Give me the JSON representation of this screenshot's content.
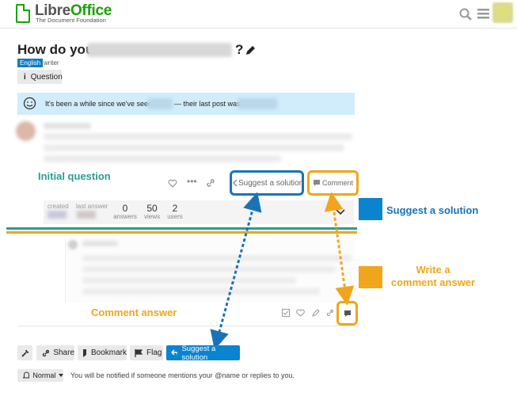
{
  "header": {
    "logo_name_prefix": "Libre",
    "logo_name_suffix": "Office",
    "logo_sub": "The Document Foundation"
  },
  "question": {
    "title_prefix": "How do you",
    "title_suffix": "?",
    "tags": [
      "English",
      "writer"
    ],
    "question_badge": "Question"
  },
  "notice": {
    "text_before": "It's been a while since we've seen",
    "text_middle": "— their last post was"
  },
  "post_actions": {
    "suggest": "Suggest a solution",
    "comment": "Comment"
  },
  "stats": {
    "created_label": "created",
    "last_answer_label": "last answer",
    "items": [
      {
        "value": "0",
        "label": "answers"
      },
      {
        "value": "50",
        "label": "views"
      },
      {
        "value": "2",
        "label": "users"
      }
    ]
  },
  "annotations": {
    "initial_question": "Initial question",
    "suggest_a_solution": "Suggest a solution",
    "write_comment_line1": "Write a",
    "write_comment_line2": "comment answer",
    "comment_answer": "Comment answer"
  },
  "footer": {
    "share": "Share",
    "bookmark": "Bookmark",
    "flag": "Flag",
    "suggest": "Suggest a solution",
    "notify_level": "Normal",
    "notify_text": "You will be notified if someone mentions your @name or replies to you."
  },
  "colors": {
    "blue": "#1a73b8",
    "orange": "#f1a51c",
    "green": "#2a9d8f",
    "notice_bg": "#d1ecfb"
  }
}
